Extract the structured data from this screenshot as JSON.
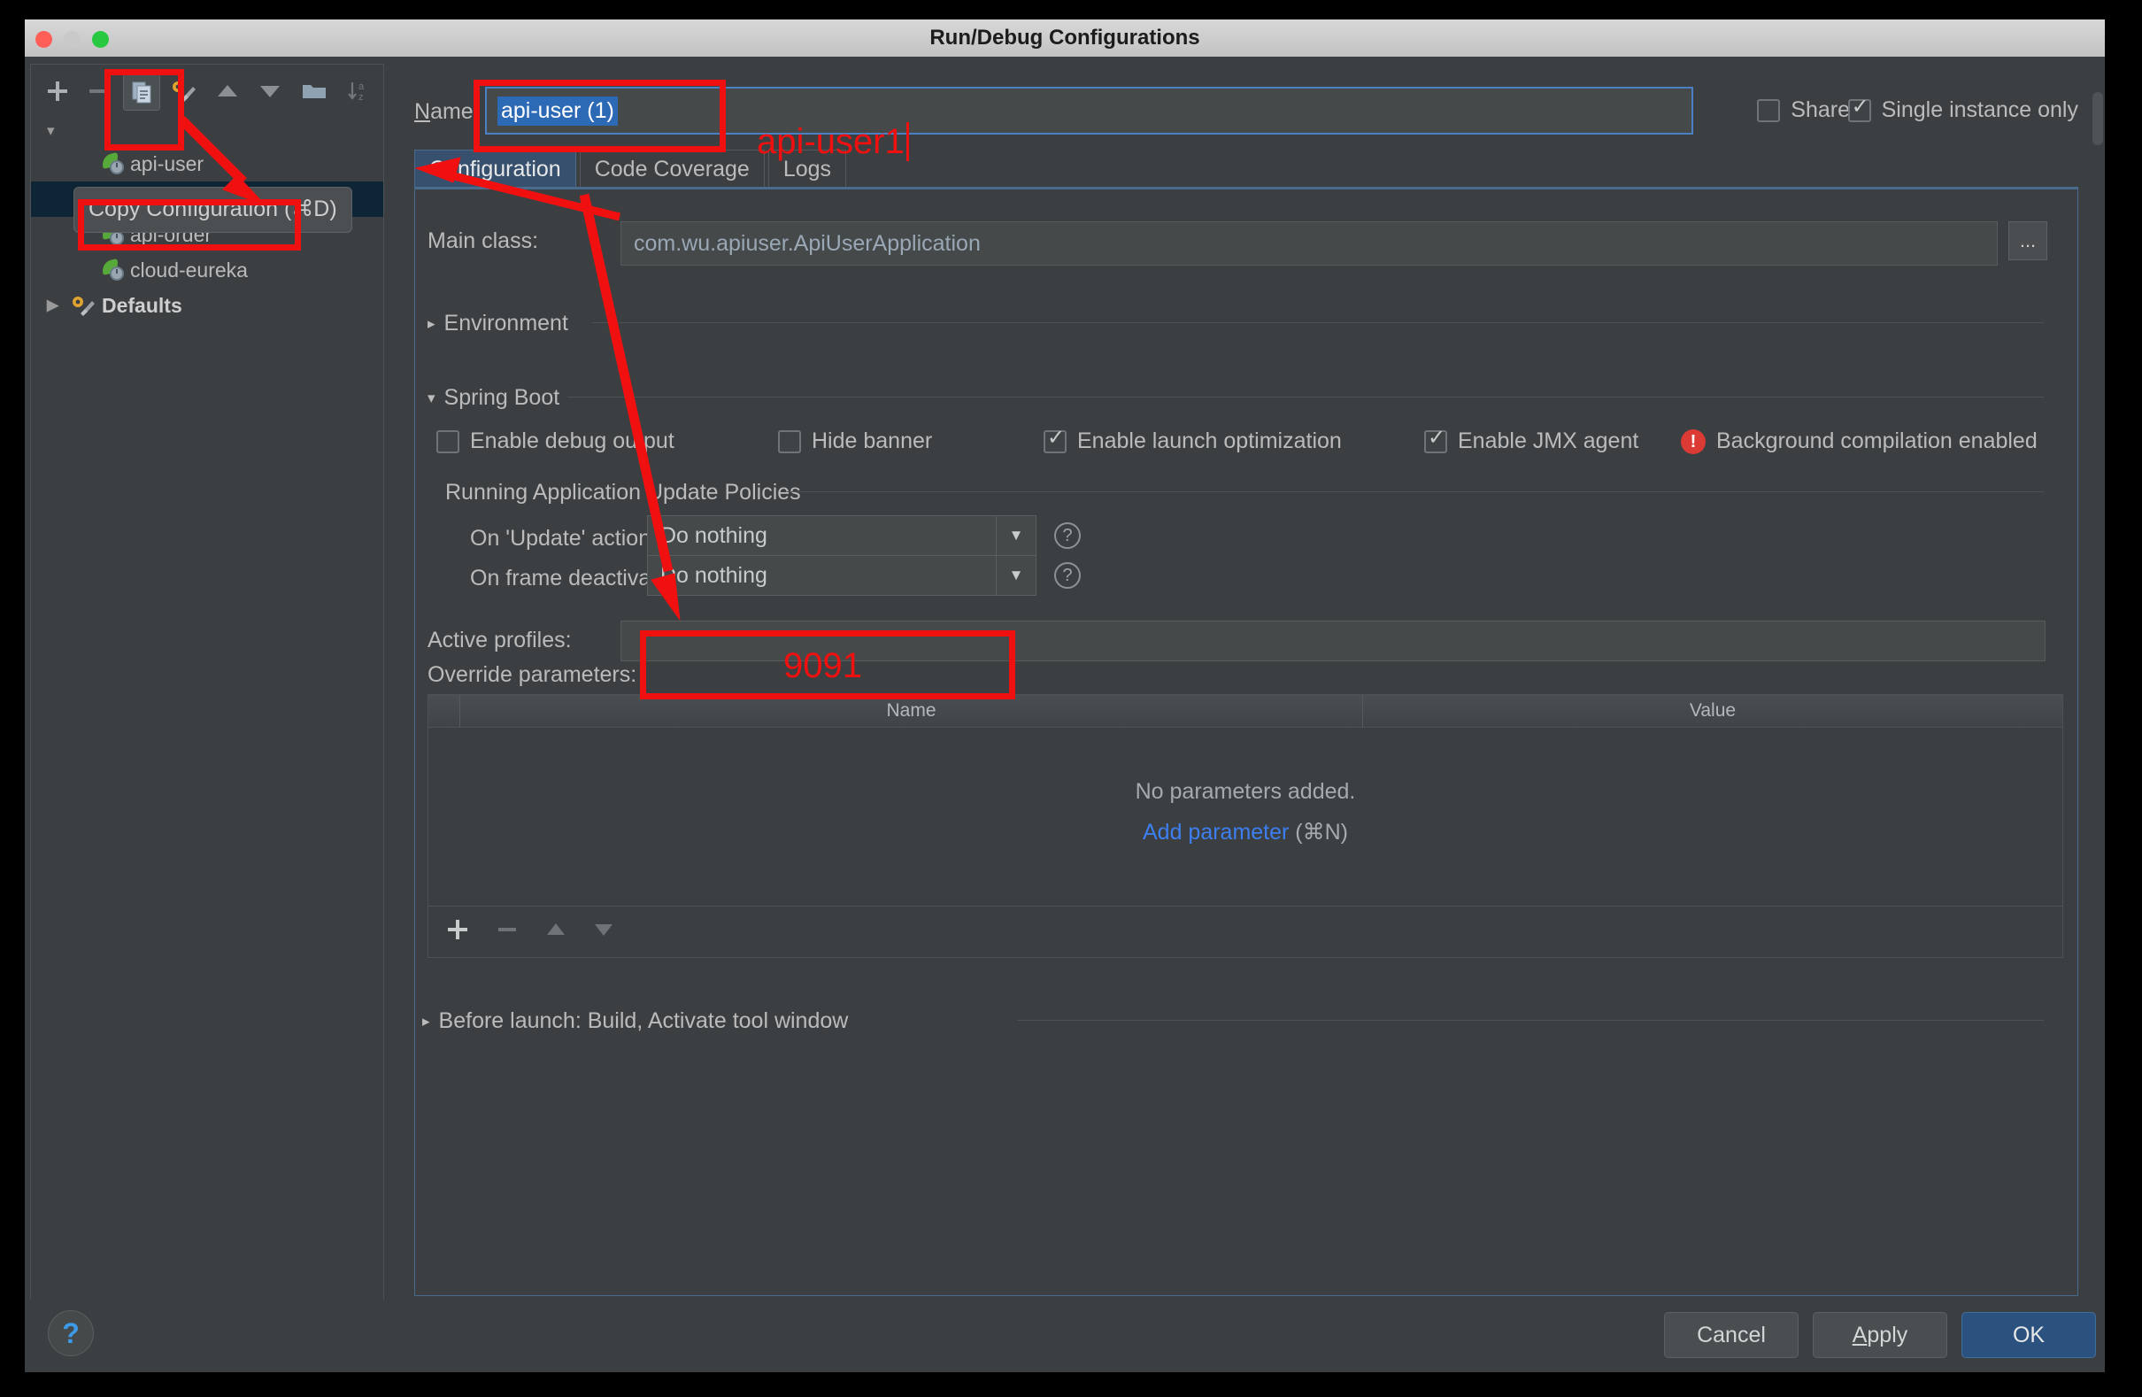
{
  "window": {
    "title": "Run/Debug Configurations"
  },
  "toolbar": {
    "add": "+",
    "remove": "−",
    "copy": "copy-configuration",
    "save": "save-configuration",
    "move_up": "▲",
    "move_down": "▼",
    "folder": "folder",
    "sort": "sort-alphabetically",
    "tooltip": "Copy Configuration (⌘D)"
  },
  "tree": {
    "items": [
      {
        "label": "api-user",
        "selected": false,
        "icon": "spring-boot-icon"
      },
      {
        "label": "api-user (1)",
        "selected": true,
        "icon": "spring-boot-icon"
      },
      {
        "label": "api-order",
        "selected": false,
        "icon": "spring-boot-icon"
      },
      {
        "label": "cloud-eureka",
        "selected": false,
        "icon": "spring-boot-icon"
      }
    ],
    "defaults": {
      "label": "Defaults",
      "arrow": "▶",
      "icon": "gear-wrench-icon"
    }
  },
  "name_row": {
    "label_prefix": "N",
    "label_rest": "ame",
    "value": "api-user (1)",
    "share_label": "Share",
    "share_checked": false,
    "single_instance_label": "Single instance only",
    "single_instance_checked": true
  },
  "tabs": [
    {
      "label": "Configuration",
      "active": true
    },
    {
      "label": "Code Coverage",
      "active": false
    },
    {
      "label": "Logs",
      "active": false
    }
  ],
  "main_class": {
    "label": "Main class:",
    "value": "com.wu.apiuser.ApiUserApplication",
    "browse_label": "..."
  },
  "environment": {
    "label": "Environment",
    "triangle": "▸"
  },
  "spring_boot": {
    "label": "Spring Boot",
    "triangle": "▾",
    "checkboxes": [
      {
        "label": "Enable debug output",
        "checked": false
      },
      {
        "label": "Hide banner",
        "checked": false
      },
      {
        "label": "Enable launch optimization",
        "checked": true
      },
      {
        "label": "Enable JMX agent",
        "checked": true
      }
    ],
    "warning": {
      "icon": "error-icon",
      "text": "Background compilation enabled"
    }
  },
  "update_policies": {
    "title": "Running Application Update Policies",
    "rows": [
      {
        "label_prefix": "On '",
        "label_mnemonic": "U",
        "label_suffix": "pdate' action:",
        "label_full": "On 'Update' action:",
        "value": "Do nothing",
        "arrow": "▼",
        "help": "?"
      },
      {
        "label_full": "On frame deactivation:",
        "label_prefix": "On ",
        "label_mnemonic": "f",
        "label_suffix": "rame deactivation:",
        "value": "Do nothing",
        "arrow": "▼",
        "help": "?"
      }
    ]
  },
  "active_profiles": {
    "label": "Active profiles:",
    "value": ""
  },
  "override_parameters": {
    "label_prefix": "Override ",
    "label_mnemonic": "p",
    "label_suffix": "arameters:",
    "label_full": "Override parameters:",
    "columns": [
      "Name",
      "Value"
    ],
    "empty_text": "No parameters added.",
    "add_link": "Add parameter",
    "add_hint": " (⌘N)",
    "rows": [],
    "toolbar": [
      "+",
      "−",
      "▲",
      "▼"
    ]
  },
  "before_launch": {
    "triangle": "▸",
    "label_mnemonic": "B",
    "label_rest": "efore launch: Build, Activate tool window",
    "label_full": "Before launch: Build, Activate tool window"
  },
  "footer": {
    "help": "?",
    "cancel": "Cancel",
    "apply_mnemonic": "A",
    "apply_rest": "pply",
    "apply_full": "Apply",
    "ok": "OK"
  },
  "annotations": {
    "name_field_text": "api-user1",
    "active_profiles_text": "9091",
    "color": "#f01010"
  },
  "colors": {
    "accent": "#3d7ff0",
    "selection": "#2d6ab5",
    "primary_button": "#2b527e",
    "annotation": "#f01010",
    "error": "#db3b34",
    "window_bg": "#3c3f41"
  }
}
